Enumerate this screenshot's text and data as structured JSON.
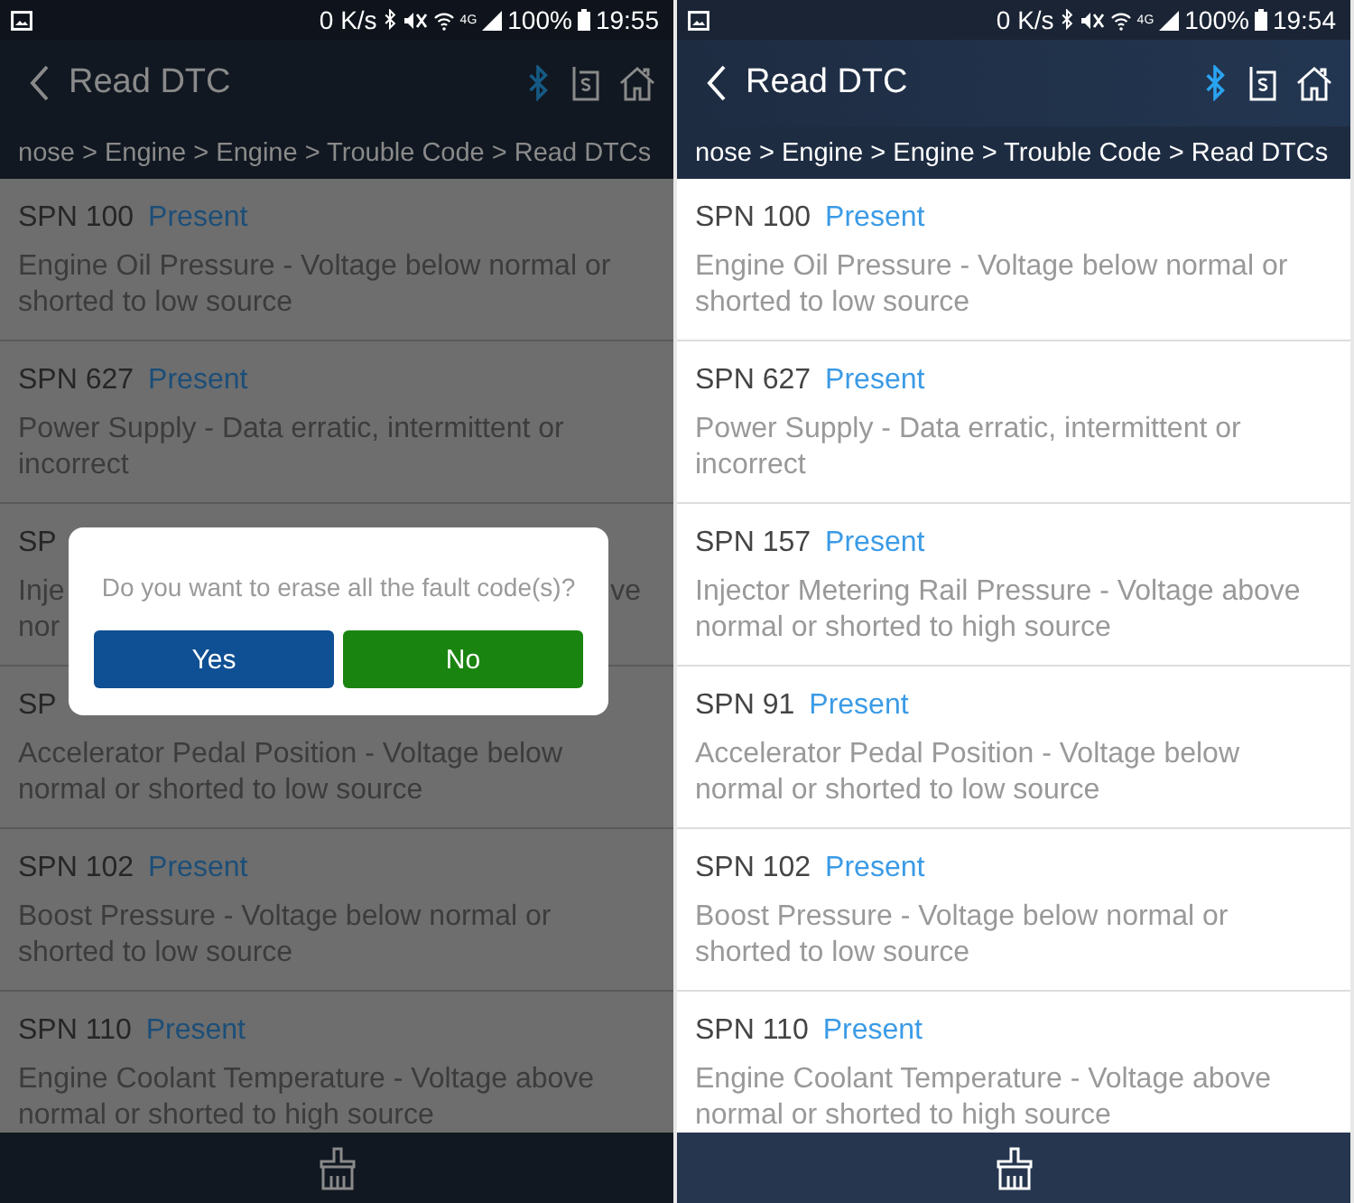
{
  "screens": [
    {
      "dimmed": true,
      "status": {
        "speed": "0 K/s",
        "network": "4G",
        "battery": "100%",
        "time": "19:55"
      },
      "title": "Read DTC",
      "breadcrumb": "nose > Engine > Engine > Trouble Code > Read DTCs",
      "items": [
        {
          "code": "SPN 100",
          "status": "Present",
          "lines": [
            "Engine Oil Pressure - Voltage below normal or",
            "shorted to low source"
          ]
        },
        {
          "code": "SPN 627",
          "status": "Present",
          "lines": [
            "Power Supply - Data erratic, intermittent or",
            "incorrect"
          ]
        },
        {
          "code": "SP",
          "lines": [
            "Inje",
            "nor"
          ],
          "line_tail": "ve"
        },
        {
          "code": "SP",
          "lines": [
            "Accelerator Pedal Position - Voltage below",
            "normal or shorted to low source"
          ]
        },
        {
          "code": "SPN 102",
          "status": "Present",
          "lines": [
            "Boost Pressure - Voltage below normal or",
            "shorted to low source"
          ]
        },
        {
          "code": "SPN 110",
          "status": "Present",
          "lines": [
            "Engine Coolant Temperature - Voltage above",
            "normal or shorted to high source"
          ]
        }
      ],
      "dialog": {
        "message": "Do you want to erase all the fault code(s)?",
        "buttons": [
          {
            "label": "Yes",
            "kind": "confirm"
          },
          {
            "label": "No",
            "kind": "cancel"
          }
        ]
      }
    },
    {
      "dimmed": false,
      "status": {
        "speed": "0 K/s",
        "network": "4G",
        "battery": "100%",
        "time": "19:54"
      },
      "title": "Read DTC",
      "breadcrumb": "nose > Engine > Engine > Trouble Code > Read DTCs",
      "items": [
        {
          "code": "SPN 100",
          "status": "Present",
          "lines": [
            "Engine Oil Pressure - Voltage below normal or",
            "shorted to low source"
          ]
        },
        {
          "code": "SPN 627",
          "status": "Present",
          "lines": [
            "Power Supply - Data erratic, intermittent or",
            "incorrect"
          ]
        },
        {
          "code": "SPN 157",
          "status": "Present",
          "lines": [
            "Injector Metering Rail Pressure - Voltage above",
            "normal or shorted to high source"
          ]
        },
        {
          "code": "SPN 91",
          "status": "Present",
          "lines": [
            "Accelerator Pedal Position - Voltage below",
            "normal or shorted to low source"
          ]
        },
        {
          "code": "SPN 102",
          "status": "Present",
          "lines": [
            "Boost Pressure - Voltage below normal or",
            "shorted to low source"
          ]
        },
        {
          "code": "SPN 110",
          "status": "Present",
          "lines": [
            "Engine Coolant Temperature - Voltage above",
            "normal or shorted to high source"
          ]
        }
      ]
    }
  ]
}
